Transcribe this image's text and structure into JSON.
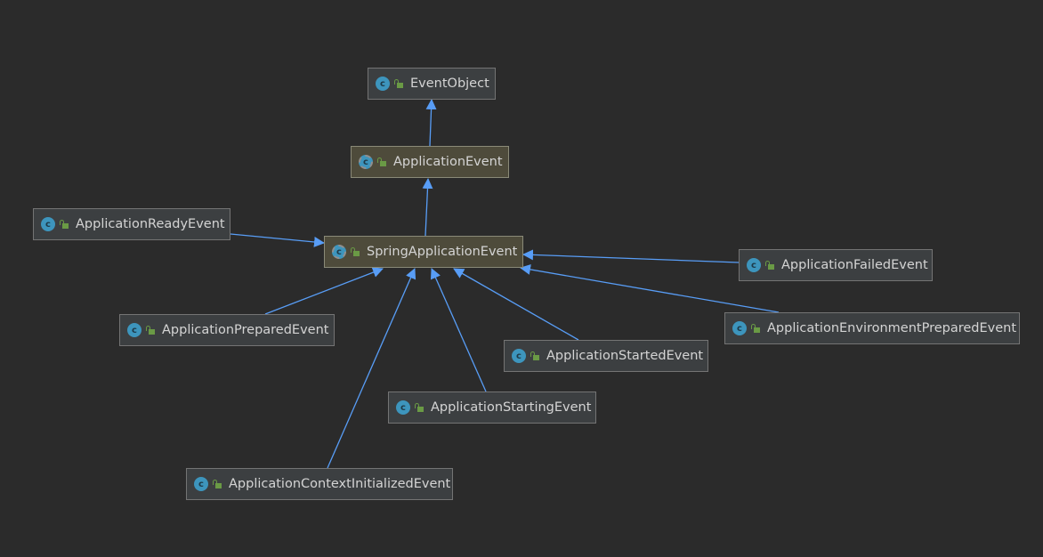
{
  "nodes": {
    "event_object": {
      "label": "EventObject",
      "icon": "class-icon",
      "kind": "class"
    },
    "application_event": {
      "label": "ApplicationEvent",
      "icon": "abstract-class-icon",
      "kind": "abstract"
    },
    "spring_application_event": {
      "label": "SpringApplicationEvent",
      "icon": "abstract-class-icon",
      "kind": "abstract"
    },
    "application_ready_event": {
      "label": "ApplicationReadyEvent",
      "icon": "class-icon",
      "kind": "class"
    },
    "application_failed_event": {
      "label": "ApplicationFailedEvent",
      "icon": "class-icon",
      "kind": "class"
    },
    "application_prepared_event": {
      "label": "ApplicationPreparedEvent",
      "icon": "class-icon",
      "kind": "class"
    },
    "application_environment_prepared_event": {
      "label": "ApplicationEnvironmentPreparedEvent",
      "icon": "class-icon",
      "kind": "class"
    },
    "application_started_event": {
      "label": "ApplicationStartedEvent",
      "icon": "class-icon",
      "kind": "class"
    },
    "application_starting_event": {
      "label": "ApplicationStartingEvent",
      "icon": "class-icon",
      "kind": "class"
    },
    "application_context_initialized_event": {
      "label": "ApplicationContextInitializedEvent",
      "icon": "class-icon",
      "kind": "class"
    }
  },
  "edges": [
    {
      "from": "application_event",
      "to": "event_object",
      "relation": "extends"
    },
    {
      "from": "spring_application_event",
      "to": "application_event",
      "relation": "extends"
    },
    {
      "from": "application_ready_event",
      "to": "spring_application_event",
      "relation": "extends"
    },
    {
      "from": "application_failed_event",
      "to": "spring_application_event",
      "relation": "extends"
    },
    {
      "from": "application_prepared_event",
      "to": "spring_application_event",
      "relation": "extends"
    },
    {
      "from": "application_environment_prepared_event",
      "to": "spring_application_event",
      "relation": "extends"
    },
    {
      "from": "application_started_event",
      "to": "spring_application_event",
      "relation": "extends"
    },
    {
      "from": "application_starting_event",
      "to": "spring_application_event",
      "relation": "extends"
    },
    {
      "from": "application_context_initialized_event",
      "to": "spring_application_event",
      "relation": "extends"
    }
  ],
  "colors": {
    "background": "#2b2b2b",
    "edge": "#589df6",
    "node_fill": "#3c3f41",
    "abstract_fill": "#4e4b3b",
    "class_icon": "#3d95bd",
    "visibility_icon": "#6a9a45",
    "text": "#d4d4d4"
  }
}
